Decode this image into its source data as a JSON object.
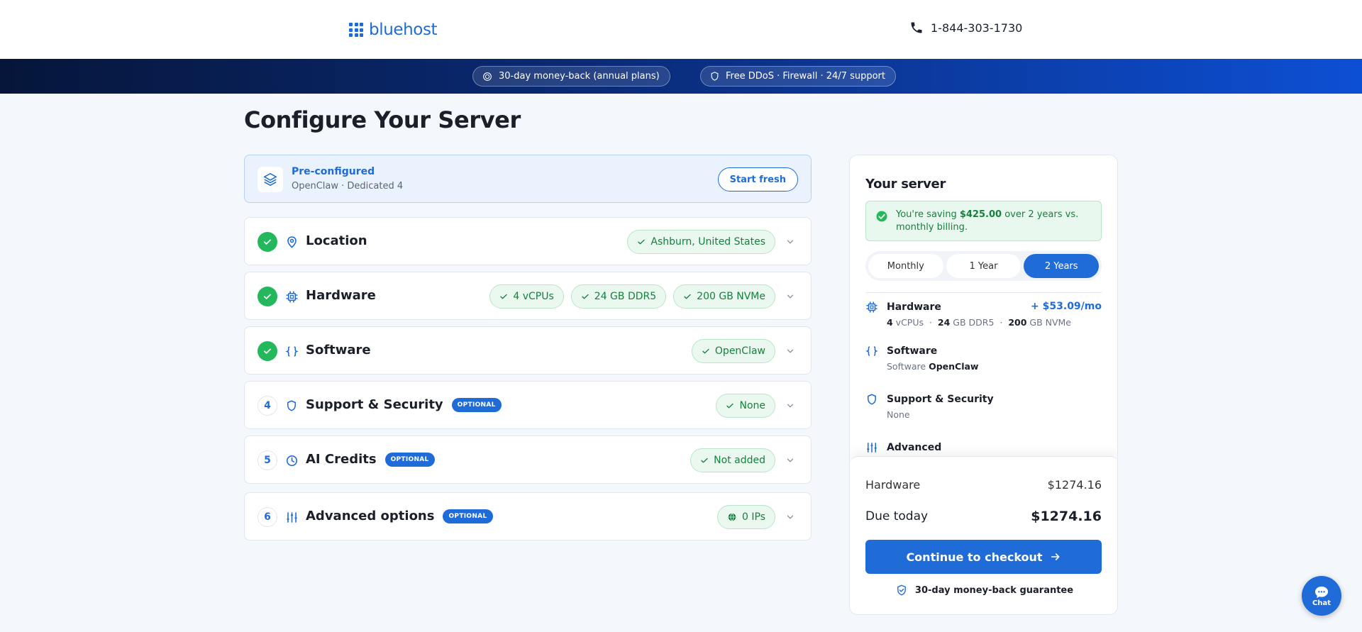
{
  "header": {
    "logo_text": "bluehost",
    "phone": "1-844-303-1730"
  },
  "banner": {
    "pill1": "30-day money-back (annual plans)",
    "pill2": "Free DDoS · Firewall · 24/7 support"
  },
  "page_title": "Configure Your Server",
  "preconfigured": {
    "title": "Pre-configured",
    "subtitle": "OpenClaw · Dedicated 4",
    "button": "Start fresh"
  },
  "sections": [
    {
      "title": "Location",
      "chips": [
        "Ashburn, United States"
      ]
    },
    {
      "title": "Hardware",
      "chips": [
        "4 vCPUs",
        "24 GB DDR5",
        "200 GB NVMe"
      ]
    },
    {
      "title": "Software",
      "chips": [
        "OpenClaw"
      ]
    },
    {
      "step": "4",
      "title": "Support & Security",
      "badge": "OPTIONAL",
      "chips": [
        "None"
      ]
    },
    {
      "step": "5",
      "title": "AI Credits",
      "badge": "OPTIONAL",
      "chips": [
        "Not added"
      ]
    },
    {
      "step": "6",
      "title": "Advanced options",
      "badge": "OPTIONAL",
      "chips": [
        "0 IPs"
      ]
    }
  ],
  "panel": {
    "title": "Your server",
    "saving": {
      "prefix": "You're saving ",
      "amount": "$425.00",
      "suffix": " over 2 years vs. monthly billing."
    },
    "billing_options": [
      "Monthly",
      "1 Year",
      "2 Years"
    ],
    "billing_selected": "2 Years",
    "items": {
      "hardware": {
        "title": "Hardware",
        "price": "+ $53.09/mo",
        "d1b": "4",
        "d1": " vCPUs",
        "d2b": "24",
        "d2": " GB DDR5",
        "d3b": "200",
        "d3": " GB NVMe",
        "sep": "·"
      },
      "software": {
        "title": "Software",
        "prefix": "Software ",
        "value": "OpenClaw"
      },
      "support": {
        "title": "Support & Security",
        "value": "None"
      },
      "advanced": {
        "title": "Advanced"
      }
    },
    "summary": {
      "hardware_label": "Hardware",
      "hardware_amount": "$1274.16",
      "due_label": "Due today",
      "due_amount": "$1274.16",
      "checkout": "Continue to checkout",
      "guarantee": "30-day money-back guarantee"
    }
  },
  "chat": {
    "label": "Chat"
  },
  "colors": {
    "accent": "#1f6bd8",
    "success": "#22b85b",
    "success_text": "#16803d"
  }
}
